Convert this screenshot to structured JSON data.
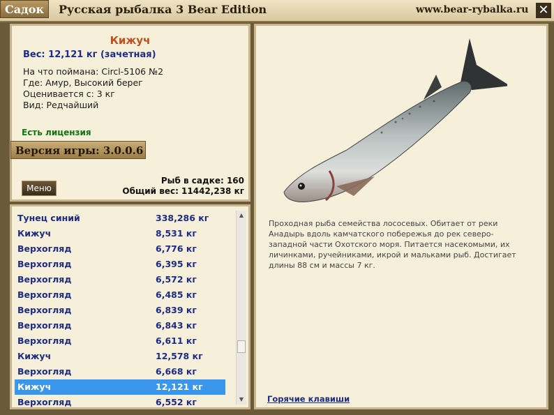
{
  "window": {
    "tab_label": "Садок",
    "title": "Русская рыбалка 3 Bear Edition",
    "site": "www.bear-rybalka.ru",
    "close_label": "✕"
  },
  "fish_card": {
    "name": "Кижуч",
    "weight_line": "Вес: 12,121 кг (зачетная)",
    "caught_with": "На что поймана: Circl-5106 №2",
    "location": "Где: Амур, Высокий берег",
    "value": "Оценивается с: 3 кг",
    "rarity": "Вид: Редчайший",
    "license": "Есть лицензия",
    "version": "Версия игры: 3.0.0.6",
    "fish_count": "Рыб в садке: 160",
    "total_weight": "Общий вес: 11442,238 кг",
    "menu_label": "Меню"
  },
  "catch_list": [
    {
      "name": "Тунец синий",
      "weight": "338,286 кг",
      "selected": false
    },
    {
      "name": "Кижуч",
      "weight": "8,531 кг",
      "selected": false
    },
    {
      "name": "Верхогляд",
      "weight": "6,776 кг",
      "selected": false
    },
    {
      "name": "Верхогляд",
      "weight": "6,395 кг",
      "selected": false
    },
    {
      "name": "Верхогляд",
      "weight": "6,572 кг",
      "selected": false
    },
    {
      "name": "Верхогляд",
      "weight": "6,485 кг",
      "selected": false
    },
    {
      "name": "Верхогляд",
      "weight": "6,839 кг",
      "selected": false
    },
    {
      "name": "Верхогляд",
      "weight": "6,843 кг",
      "selected": false
    },
    {
      "name": "Верхогляд",
      "weight": "6,611 кг",
      "selected": false
    },
    {
      "name": "Кижуч",
      "weight": "12,578 кг",
      "selected": false
    },
    {
      "name": "Верхогляд",
      "weight": "6,668 кг",
      "selected": false
    },
    {
      "name": "Кижуч",
      "weight": "12,121 кг",
      "selected": true
    },
    {
      "name": "Верхогляд",
      "weight": "6,552 кг",
      "selected": false
    }
  ],
  "description": "Проходная рыба семейства лососевых. Обитает от реки Анадырь вдоль камчатского побережья до рек северо-западной части Охотского моря. Питается насекомыми, их личинками, ручейниками, икрой и мальками рыб. Достигает длины 88 см и массы 7 кг.",
  "hotkeys_label": "Горячие клавиши",
  "colors": {
    "fish_name": "#c0501c",
    "list_text": "#1c2c86",
    "selected_row": "#3a96ea",
    "license": "#127312"
  }
}
